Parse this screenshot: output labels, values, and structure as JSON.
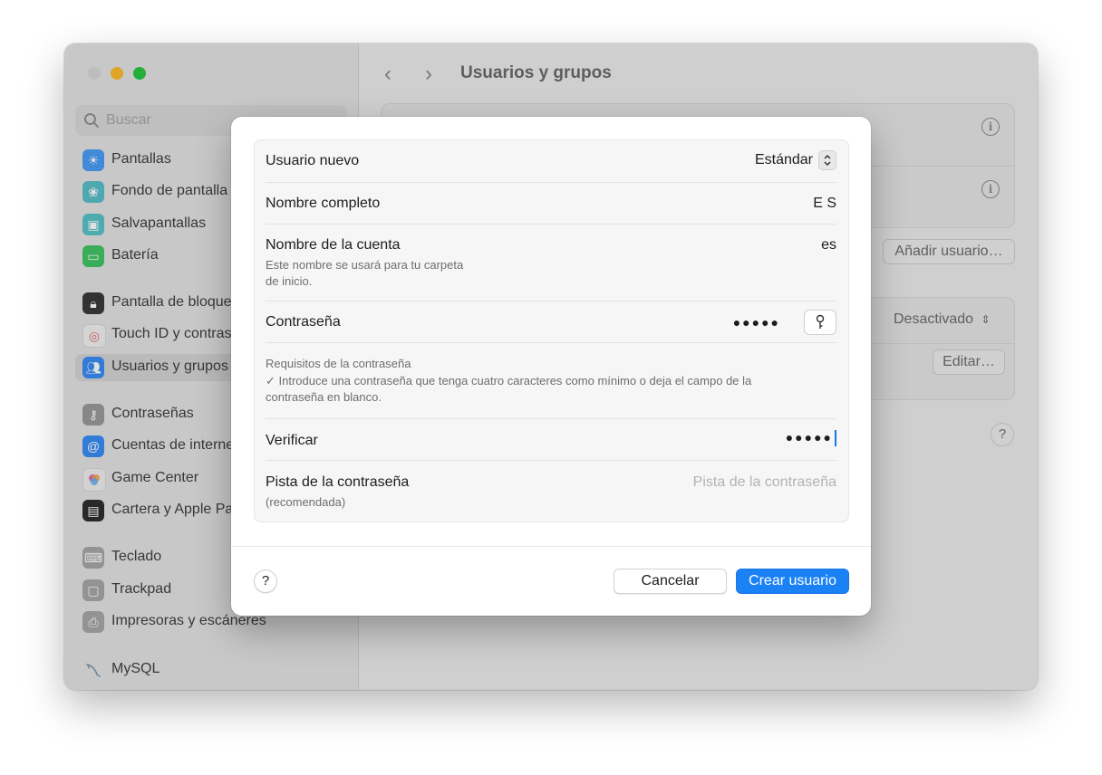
{
  "sidebar": {
    "search_placeholder": "Buscar",
    "items": [
      {
        "label": "Pantallas",
        "icon": "sun-icon",
        "color": "#4a9ef5"
      },
      {
        "label": "Fondo de pantalla",
        "icon": "flower-icon",
        "color": "#5bc0c9"
      },
      {
        "label": "Salvapantallas",
        "icon": "screensaver-icon",
        "color": "#5cc3c9"
      },
      {
        "label": "Batería",
        "icon": "battery-icon",
        "color": "#43c565"
      },
      {
        "label": "Pantalla de bloqueo",
        "icon": "lock-icon",
        "color": "#3a3a3a"
      },
      {
        "label": "Touch ID y contraseña",
        "icon": "fingerprint-icon",
        "color": "#f2f2f2"
      },
      {
        "label": "Usuarios y grupos",
        "icon": "users-icon",
        "color": "#3a8ef5"
      },
      {
        "label": "Contraseñas",
        "icon": "key-icon",
        "color": "#9a9a9a"
      },
      {
        "label": "Cuentas de internet",
        "icon": "at-icon",
        "color": "#3a8ef5"
      },
      {
        "label": "Game Center",
        "icon": "game-center-icon",
        "color": "#f0f0f0"
      },
      {
        "label": "Cartera y Apple Pay",
        "icon": "wallet-icon",
        "color": "#2f2f2f"
      },
      {
        "label": "Teclado",
        "icon": "keyboard-icon",
        "color": "#a8a8a8"
      },
      {
        "label": "Trackpad",
        "icon": "trackpad-icon",
        "color": "#a8a8a8"
      },
      {
        "label": "Impresoras y escáneres",
        "icon": "printer-icon",
        "color": "#a8a8a8"
      },
      {
        "label": "MySQL",
        "icon": "dolphin-icon",
        "color": "#e8e8e8"
      }
    ]
  },
  "main": {
    "title": "Usuarios y grupos",
    "add_user_label": "Añadir usuario…",
    "select_value": "Desactivado",
    "edit_label": "Editar…",
    "help_label": "?"
  },
  "dialog": {
    "new_user_label": "Usuario nuevo",
    "new_user_type": "Estándar",
    "full_name_label": "Nombre completo",
    "full_name_value": "E S",
    "account_name_label": "Nombre de la cuenta",
    "account_name_value": "es",
    "account_name_note_1": "Este nombre se usará para tu carpeta",
    "account_name_note_2": "de inicio.",
    "password_label": "Contraseña",
    "password_value": "●●●●●",
    "requirements_title": "Requisitos de la contraseña",
    "requirements_line_1": "✓ Introduce una contraseña que tenga cuatro caracteres como mínimo o deja el campo de la",
    "requirements_line_2": "contraseña en blanco.",
    "verify_label": "Verificar",
    "verify_value": "●●●●●",
    "hint_label": "Pista de la contraseña",
    "hint_sub": "(recomendada)",
    "hint_placeholder": "Pista de la contraseña",
    "help_label": "?",
    "cancel_label": "Cancelar",
    "create_label": "Crear usuario",
    "accent_color": "#1a82f5"
  }
}
